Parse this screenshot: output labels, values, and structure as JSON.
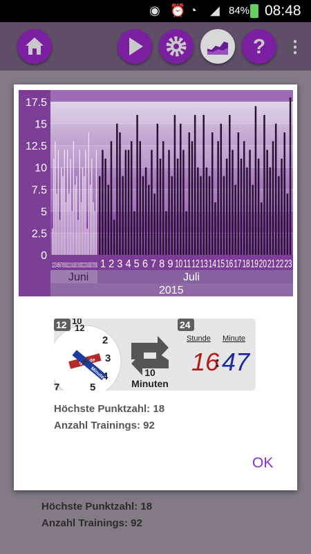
{
  "status": {
    "battery": "84%",
    "time": "08:48"
  },
  "toolbar": {
    "home": "home-icon",
    "play": "play-icon",
    "settings": "gear-icon",
    "stats": "area-chart-icon",
    "help": "help-icon",
    "menu": "overflow-menu-icon"
  },
  "dialog": {
    "highscore": "Höchste Punktzahl: 18",
    "trainings": "Anzahl Trainings: 92",
    "ok": "OK",
    "illustration": {
      "badge12": "12",
      "badge24": "24",
      "interval": "10",
      "interval_unit": "Minuten",
      "hour_label": "Stunde",
      "minute_label": "Minute",
      "digital_hour": "16",
      "digital_minute": "47",
      "hand_hour": "Stunde",
      "hand_minute": "Minute",
      "clock_numbers": [
        "10",
        "12",
        "2",
        "3",
        "4",
        "5",
        "7"
      ]
    }
  },
  "background": {
    "highscore": "Höchste Punktzahl: 18",
    "trainings": "Anzahl Trainings: 92"
  },
  "chart_data": {
    "type": "bar",
    "ylim": [
      0,
      17.5
    ],
    "yticks": [
      "17.5",
      "15",
      "12.5",
      "10",
      "7.5",
      "5",
      "2.5",
      "0"
    ],
    "months": [
      "Juni",
      "Juli"
    ],
    "year": "2015",
    "june_tick_labels": [
      "1",
      "2",
      "3",
      "4",
      "5",
      "6",
      "7",
      "8",
      "9",
      "10",
      "11",
      "12",
      "13",
      "14",
      "15",
      "16",
      "17",
      "18",
      "19",
      "20",
      "21",
      "22",
      "23",
      "24",
      "25",
      "26",
      "27",
      "28",
      "29",
      "30"
    ],
    "july_tick_labels": [
      "1",
      "2",
      "3",
      "4",
      "5",
      "6",
      "7",
      "8",
      "9",
      "10",
      "11",
      "12",
      "13",
      "14",
      "15",
      "16",
      "17",
      "18",
      "19",
      "20",
      "21",
      "22",
      "23"
    ],
    "june_values": [
      3,
      11,
      13,
      7,
      12,
      4,
      10,
      9,
      12,
      6,
      12,
      7,
      11,
      5,
      13,
      8,
      9,
      4,
      12,
      6,
      10,
      9,
      12,
      3,
      14,
      8,
      11,
      6,
      5,
      12
    ],
    "july_values": [
      9,
      12,
      11,
      8,
      13,
      4,
      15,
      14,
      9,
      12,
      12,
      13,
      5,
      16,
      13,
      9,
      10,
      8,
      12,
      7,
      15,
      11,
      13,
      5,
      12,
      9,
      16,
      11,
      15,
      12,
      5,
      14,
      13,
      16,
      10,
      9,
      16,
      10,
      9,
      14,
      6,
      13,
      15,
      9,
      11,
      16,
      12,
      8,
      14,
      11,
      13,
      10,
      12,
      8,
      17,
      11,
      6,
      16,
      12,
      10,
      13,
      15,
      9,
      11,
      14,
      7,
      18
    ]
  }
}
